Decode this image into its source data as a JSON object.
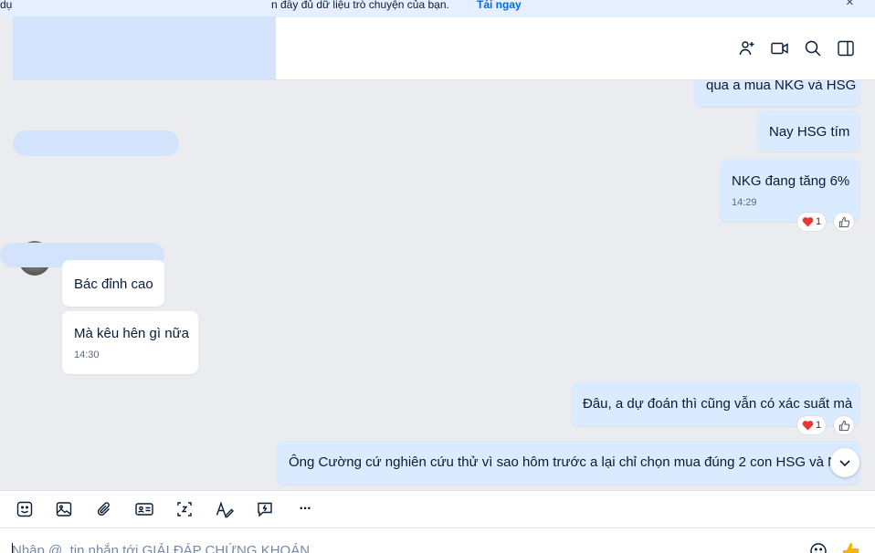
{
  "banner": {
    "left_text": "dụ",
    "text": "n đầy đủ dữ liệu trò chuyện của bạn.",
    "link": "Tải ngay",
    "close": "×"
  },
  "header": {
    "icons": [
      "add-member-icon",
      "video-call-icon",
      "search-icon",
      "sidebar-toggle-icon"
    ]
  },
  "messages": [
    {
      "id": "m1",
      "from": "me",
      "text": "qua a mua NKG và HSG"
    },
    {
      "id": "m2",
      "from": "me",
      "text": "Nay HSG tím"
    },
    {
      "id": "m3",
      "from": "me",
      "text": "NKG đang tăng 6%",
      "time": "14:29",
      "reaction": {
        "emoji": "❤️",
        "count": "1"
      }
    },
    {
      "id": "m4",
      "from": "other",
      "text": "Bác đỉnh cao"
    },
    {
      "id": "m5",
      "from": "other",
      "text": "Mà kêu hên gì nữa",
      "time": "14:30"
    },
    {
      "id": "m6",
      "from": "me",
      "text": "Đâu, a dự đoán thì cũng vẫn có xác suất mà",
      "reaction": {
        "emoji": "❤️",
        "count": "1"
      }
    },
    {
      "id": "m7",
      "from": "me",
      "text": "Ông Cường cứ nghiên cứu thử vì sao hôm trước a lại chỉ chọn mua đúng 2 con HSG và N"
    }
  ],
  "toolbar": {
    "icons": [
      "sticker-icon",
      "image-icon",
      "attachment-icon",
      "contact-card-icon",
      "screenshot-icon",
      "text-format-icon",
      "quick-message-icon",
      "more-icon"
    ],
    "more_label": "···"
  },
  "composer": {
    "placeholder": "Nhập @, tin nhắn tới GIẢI ĐÁP CHỨNG KHOÁN"
  },
  "colors": {
    "accent": "#0068ff",
    "own_bubble": "#dbebff",
    "other_bubble": "#ffffff",
    "chat_bg": "#ebecf0",
    "heart": "#e53935",
    "emoji_yellow": "#f5b400"
  }
}
